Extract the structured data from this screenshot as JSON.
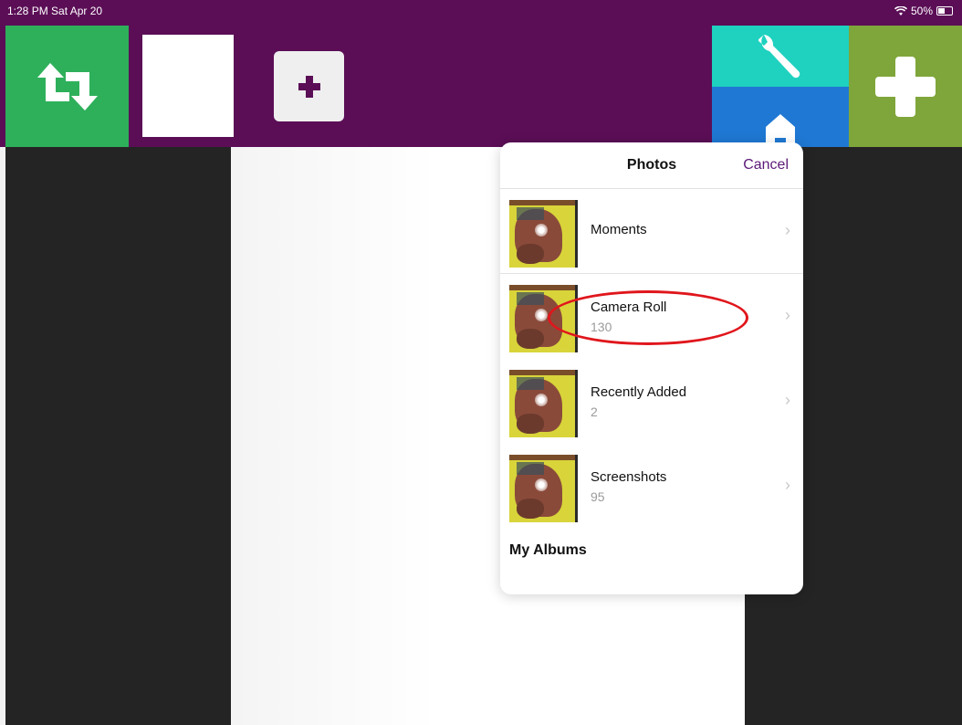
{
  "status_bar": {
    "time_date": "1:28 PM  Sat Apr 20",
    "battery": "50%"
  },
  "toolbar": {
    "icons": [
      "swap-icon",
      "blank-card",
      "plus-icon",
      "wrench-icon",
      "home-icon",
      "plus-icon"
    ]
  },
  "popover": {
    "title": "Photos",
    "cancel_label": "Cancel",
    "albums": [
      {
        "name": "Moments",
        "count": ""
      },
      {
        "name": "Camera Roll",
        "count": "130"
      },
      {
        "name": "Recently Added",
        "count": "2"
      },
      {
        "name": "Screenshots",
        "count": "95"
      }
    ],
    "section_title": "My Albums"
  },
  "annotation": {
    "color": "#e0161c",
    "target": "Camera Roll"
  },
  "colors": {
    "brand_purple": "#5b0e56",
    "swap_green": "#2eb05b",
    "wrench_teal": "#1fd1bf",
    "home_blue": "#1f78d3",
    "add_green": "#7fa63a",
    "cancel_purple": "#5b1a78"
  }
}
